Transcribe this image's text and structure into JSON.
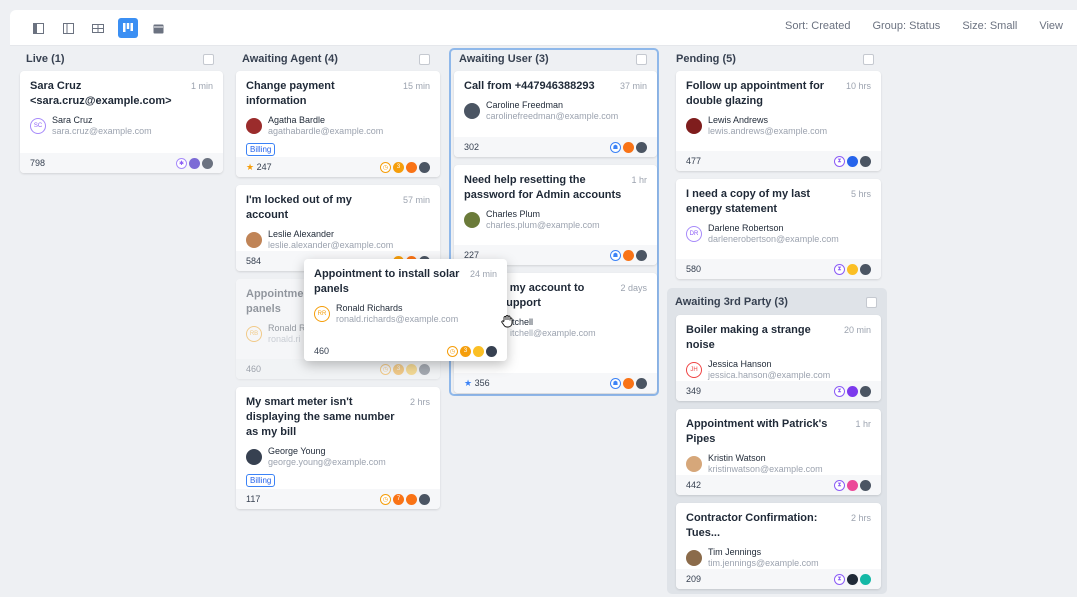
{
  "toolbar": {
    "sort": "Sort: Created",
    "group": "Group: Status",
    "size": "Size: Small",
    "view": "View"
  },
  "columns": {
    "live": "Live (1)",
    "awaiting_agent": "Awaiting Agent (4)",
    "awaiting_user": "Awaiting User (3)",
    "pending": "Pending (5)",
    "awaiting_3rd": "Awaiting 3rd Party (3)"
  },
  "cards": {
    "c1": {
      "title1": "Sara Cruz",
      "title2": "<sara.cruz@example.com>",
      "time": "1 min",
      "initials": "SC",
      "name": "Sara Cruz",
      "email": "sara.cruz@example.com",
      "id": "798"
    },
    "c2": {
      "title": "Change payment information",
      "time": "15 min",
      "name": "Agatha Bardle",
      "email": "agathabardle@example.com",
      "tag": "Billing",
      "id": "247",
      "count": "3"
    },
    "c3": {
      "title": "I'm locked out of my account",
      "time": "57 min",
      "name": "Leslie Alexander",
      "email": "leslie.alexander@example.com",
      "id": "584"
    },
    "c4": {
      "title": "Appointmer",
      "title2": "panels",
      "initials": "RB",
      "name": "Ronald R",
      "email": "ronald.ri",
      "id": "460",
      "count": "3"
    },
    "c5": {
      "title": "My smart meter isn't displaying the same number as my bill",
      "time": "2 hrs",
      "name": "George Young",
      "email": "george.young@example.com",
      "tag": "Billing",
      "id": "117",
      "count": "7"
    },
    "c6": {
      "title": "Call from +447946388293",
      "time": "37 min",
      "name": "Caroline Freedman",
      "email": "carolinefreedman@example.com",
      "id": "302"
    },
    "c7": {
      "title": "Need help resetting the password for Admin accounts",
      "time": "1 hr",
      "name": "Charles Plum",
      "email": "charles.plum@example.com",
      "id": "227"
    },
    "c8": {
      "title1": "g my account to",
      "title2": "support",
      "time": "2 days",
      "name": "itchell",
      "email": "itchell@example.com",
      "id": "356"
    },
    "c9": {
      "title": "Follow up appointment for double glazing",
      "time": "10 hrs",
      "name": "Lewis Andrews",
      "email": "lewis.andrews@example.com",
      "id": "477"
    },
    "c10": {
      "title": "I need a copy of my last energy statement",
      "time": "5 hrs",
      "initials": "DR",
      "name": "Darlene Robertson",
      "email": "darlenerobertson@example.com",
      "id": "580"
    },
    "c11": {
      "title": "Boiler making a strange noise",
      "time": "20 min",
      "initials": "JH",
      "name": "Jessica Hanson",
      "email": "jessica.hanson@example.com",
      "id": "349"
    },
    "c12": {
      "title": "Appointment with Patrick's Pipes",
      "time": "1 hr",
      "name": "Kristin Watson",
      "email": "kristinwatson@example.com",
      "id": "442"
    },
    "c13": {
      "title": "Contractor Confirmation: Tues...",
      "time": "2 hrs",
      "name": "Tim Jennings",
      "email": "tim.jennings@example.com",
      "id": "209"
    },
    "drag": {
      "title": "Appointment to install solar panels",
      "time": "24 min",
      "initials": "RR",
      "name": "Ronald Richards",
      "email": "ronald.richards@example.com",
      "id": "460",
      "count": "3"
    }
  },
  "colors": {
    "accent": "#3b8ff3",
    "tag": "#3b82f6",
    "star": "#f59e0b"
  }
}
